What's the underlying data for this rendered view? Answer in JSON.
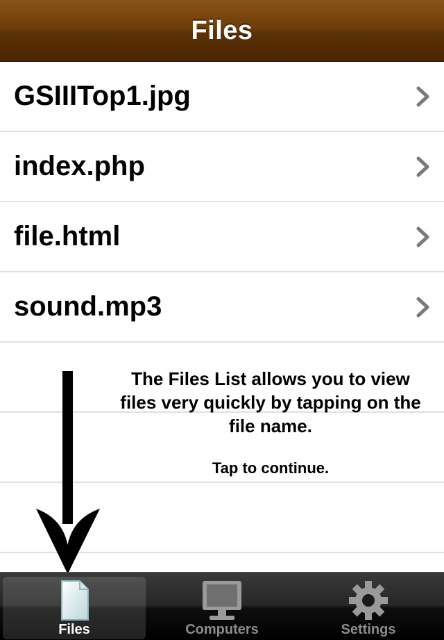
{
  "navbar": {
    "title": "Files"
  },
  "files": [
    {
      "name": "GSIIITop1.jpg"
    },
    {
      "name": "index.php"
    },
    {
      "name": "file.html"
    },
    {
      "name": "sound.mp3"
    }
  ],
  "tutorial": {
    "message": "The Files List allows you to view files very quickly by tapping on the file name.",
    "continue_label": "Tap to continue."
  },
  "tabbar": {
    "tabs": [
      {
        "label": "Files",
        "icon": "document-icon",
        "selected": true
      },
      {
        "label": "Computers",
        "icon": "monitor-icon",
        "selected": false
      },
      {
        "label": "Settings",
        "icon": "gear-icon",
        "selected": false
      }
    ]
  },
  "colors": {
    "navbar": "#6e3d0b",
    "separator": "#e0e0e0",
    "tab_selected_label": "#ffffff",
    "tab_label": "#8c8c8c"
  }
}
